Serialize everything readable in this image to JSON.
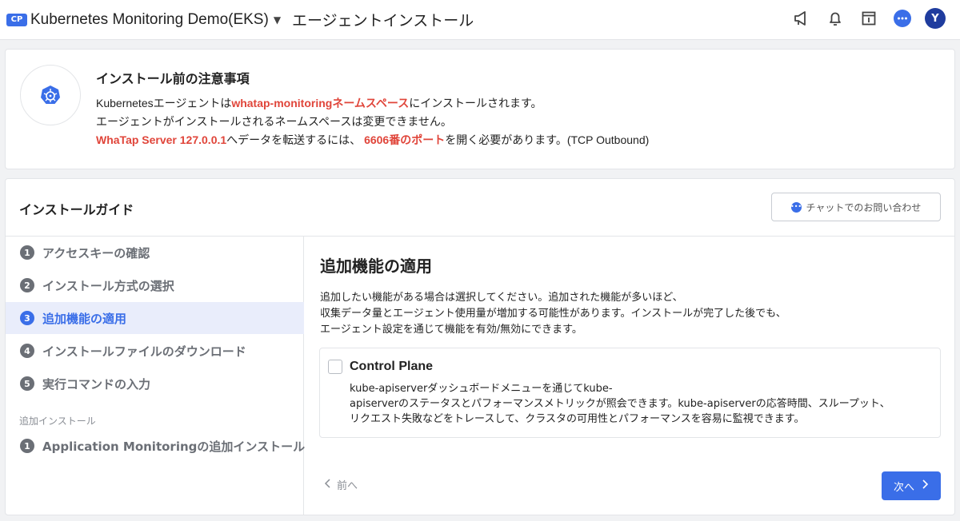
{
  "header": {
    "badge": "CP",
    "project": "Kubernetes Monitoring Demo(EKS)",
    "page_title": "エージェントインストール",
    "avatar_initial": "Y",
    "icons": [
      "megaphone-icon",
      "bell-icon",
      "calendar-icon",
      "chat-icon"
    ]
  },
  "notice": {
    "title": "インストール前の注意事項",
    "line1": {
      "pre": "Kubernetesエージェントは",
      "highlight": "whatap-monitoringネームスペース",
      "post": "にインストールされます。"
    },
    "line2": "エージェントがインストールされるネームスペースは変更できません。",
    "line3": {
      "highlight1": "WhaTap Server 127.0.0.1",
      "mid": "へデータを転送するには、",
      "highlight2": "6606番のポート",
      "post": "を開く必要があります。(TCP Outbound)"
    }
  },
  "guide": {
    "title": "インストールガイド",
    "chat_button": "チャットでのお問い合わせ",
    "steps": [
      {
        "num": "1",
        "label": "アクセスキーの確認"
      },
      {
        "num": "2",
        "label": "インストール方式の選択"
      },
      {
        "num": "3",
        "label": "追加機能の適用"
      },
      {
        "num": "4",
        "label": "インストールファイルのダウンロード"
      },
      {
        "num": "5",
        "label": "実行コマンドの入力"
      }
    ],
    "extra_section_label": "追加インストール",
    "extra_steps": [
      {
        "num": "1",
        "label": "Application Monitoringの追加インストール"
      }
    ]
  },
  "content": {
    "title": "追加機能の適用",
    "desc_lines": [
      "追加したい機能がある場合は選択してください。追加された機能が多いほど、",
      "収集データ量とエージェント使用量が増加する可能性があります。インストールが完了した後でも、",
      "エージェント設定を通じて機能を有効/無効にできます。"
    ],
    "option": {
      "title": "Control Plane",
      "desc_lines": [
        "kube-apiserverダッシュボードメニューを通じてkube-",
        "apiserverのステータスとパフォーマンスメトリックが照会できます。kube-apiserverの応答時間、スループット、",
        "リクエスト失敗などをトレースして、クラスタの可用性とパフォーマンスを容易に監視できます。"
      ],
      "checked": false
    },
    "prev_label": "前へ",
    "next_label": "次へ"
  },
  "colors": {
    "accent": "#3a6ee8",
    "highlight_red": "#e0453a",
    "avatar_bg": "#1f3c9e"
  }
}
